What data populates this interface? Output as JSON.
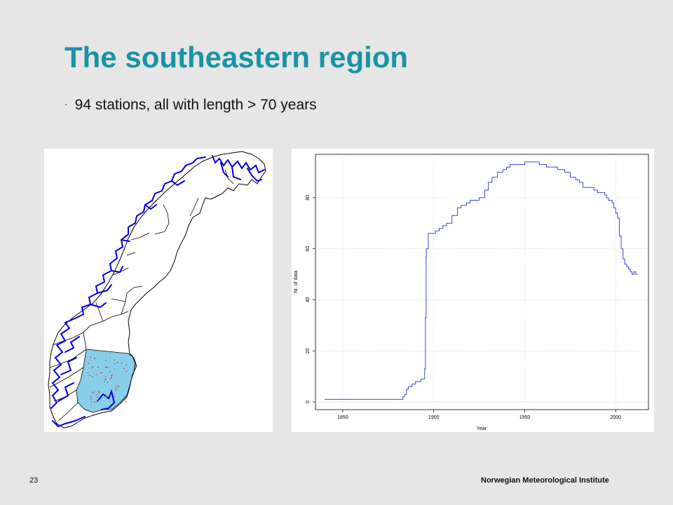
{
  "slide": {
    "title": "The southeastern region",
    "bullet": "94 stations, all with length > 70 years",
    "bullet_marker": "·",
    "page_number": "23",
    "footer_org": "Norwegian Meteorological Institute",
    "accent_color": "#1a93a6"
  },
  "map": {
    "highlight_color": "#87ceeb",
    "river_color": "#0000dd",
    "station_color": "#c0504d"
  },
  "chart_data": {
    "type": "line",
    "xlabel": "Year",
    "ylabel": "Nr. of data",
    "xlim": [
      1835,
      2018
    ],
    "ylim": [
      -3,
      97
    ],
    "xticks": [
      1850,
      1900,
      1950,
      2000
    ],
    "yticks": [
      0,
      20,
      40,
      60,
      80
    ],
    "grid": true,
    "line_color": "#3b49d6",
    "series": [
      {
        "x": [
          1840,
          1875,
          1876,
          1882,
          1883,
          1884,
          1885,
          1886,
          1887,
          1888,
          1889,
          1890,
          1891,
          1892,
          1893,
          1894,
          1895,
          1895.4,
          1895.8,
          1896,
          1897,
          1900,
          1901,
          1903,
          1905,
          1907,
          1910,
          1913,
          1915,
          1918,
          1920,
          1922,
          1925,
          1928,
          1930,
          1932,
          1935,
          1938,
          1940,
          1942,
          1945,
          1948,
          1950,
          1952,
          1955,
          1958,
          1960,
          1962,
          1965,
          1968,
          1970,
          1972,
          1975,
          1978,
          1980,
          1982,
          1985,
          1988,
          1990,
          1992,
          1994,
          1995,
          1996,
          1997,
          1998,
          1999,
          2000,
          2001,
          2002,
          2003,
          2004,
          2005,
          2006,
          2007,
          2008,
          2009,
          2010,
          2011,
          2012
        ],
        "y": [
          1,
          1,
          1,
          1,
          2,
          3,
          5,
          6,
          6,
          7,
          7,
          8,
          8,
          8,
          9,
          9,
          13,
          33,
          57,
          60,
          66,
          66,
          67,
          68,
          69,
          70,
          73,
          76,
          77,
          78,
          79,
          79,
          80,
          83,
          86,
          88,
          90,
          91,
          92,
          93,
          93,
          93,
          94,
          94,
          94,
          93,
          93,
          92,
          92,
          91,
          91,
          90,
          88,
          87,
          86,
          84,
          84,
          83,
          82,
          82,
          81,
          80,
          79,
          79,
          78,
          76,
          74,
          72,
          65,
          60,
          56,
          54,
          53,
          52,
          51,
          50,
          51,
          50,
          50
        ]
      }
    ]
  }
}
